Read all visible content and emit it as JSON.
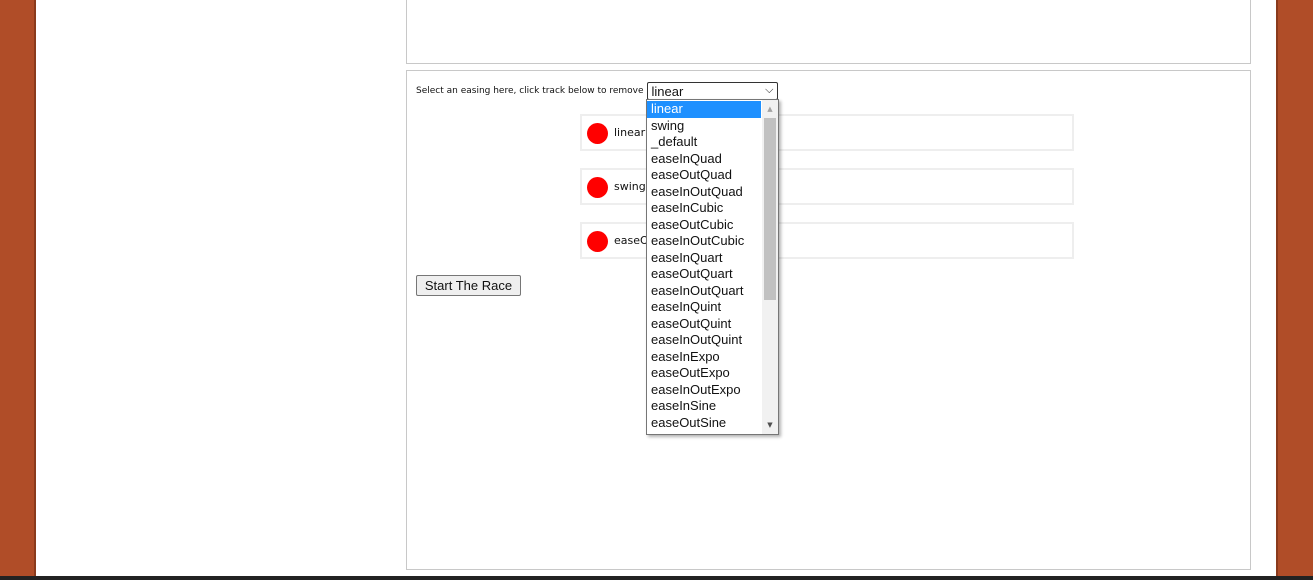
{
  "easing": {
    "label": "Select an easing here, click track below to remove",
    "selected": "linear",
    "options": [
      "linear",
      "swing",
      "_default",
      "easeInQuad",
      "easeOutQuad",
      "easeInOutQuad",
      "easeInCubic",
      "easeOutCubic",
      "easeInOutCubic",
      "easeInQuart",
      "easeOutQuart",
      "easeInOutQuart",
      "easeInQuint",
      "easeOutQuint",
      "easeInOutQuint",
      "easeInExpo",
      "easeOutExpo",
      "easeInOutExpo",
      "easeInSine",
      "easeOutSine"
    ]
  },
  "tracks": [
    {
      "label": "linear"
    },
    {
      "label": "swing"
    },
    {
      "label": "easeO"
    }
  ],
  "start_button": "Start The Race",
  "colors": {
    "frame": "#b04d28",
    "ball": "#ff0000",
    "selected_option": "#1e90ff"
  }
}
